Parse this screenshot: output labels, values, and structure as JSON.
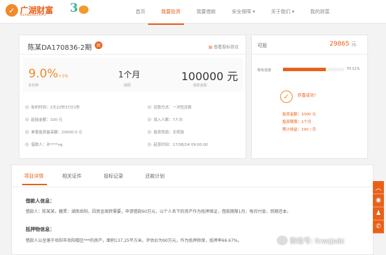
{
  "brand": {
    "name": "广湖财富",
    "sub": "GUANGHUCAIFU",
    "anniv": "3"
  },
  "nav": [
    "首页",
    "我要投资",
    "我要借款",
    "安全保障 ▾",
    "关于我们 ▾",
    "我的财富"
  ],
  "loan": {
    "title": "陈某DA170836-2期",
    "badge": "担",
    "protocol": "查看投标协议",
    "rate": "9.0%",
    "rate_plus": "+1%",
    "rate_label": "年利率",
    "term": "1个月",
    "term_label": "期限",
    "amount": "100000 元",
    "amount_label": "借款金额"
  },
  "info": [
    "标的时间：2天22时37分1秒",
    "还款方式：一次性还款",
    "起投金额：100 元",
    "加入人数：7人次",
    "单笔投资最高额：20000.0 元",
    "投资奖励：无奖励",
    "借款人：许****ng",
    "起息时间：17/08/24 09:00:00"
  ],
  "side": {
    "label": "可投",
    "value": "29865",
    "unit": "元",
    "progress_label": "筹标进度",
    "progress_text": "70.11%",
    "progress": 0.7011,
    "success": "恭喜成功！",
    "rows": [
      "投资金额：1000 元",
      "投资期限：1个月",
      "预计收益：190 / 月"
    ]
  },
  "tabs": [
    "项目详情",
    "相关证件",
    "投标记录",
    "还款计划"
  ],
  "detail": {
    "h1": "借款人信息：",
    "p1": "借款人：陈某某，籍贯：湖南岳阳，因资金周转需要，申请借款60万元，以个人名下的资产作为抵押保证，借款期限1月，每月付息，到期还本。",
    "h2": "抵押物信息：",
    "p2": "借款人以坐落于岳阳市岳阳楼区***的房产，面积137.25平方米，评估价为90万元，作为抵押担保，抵押率66.67%。"
  },
  "sidebar_icons": [
    "top",
    "weibo",
    "qq",
    "phone"
  ],
  "watermark": "微信号: fcwzjsdz"
}
